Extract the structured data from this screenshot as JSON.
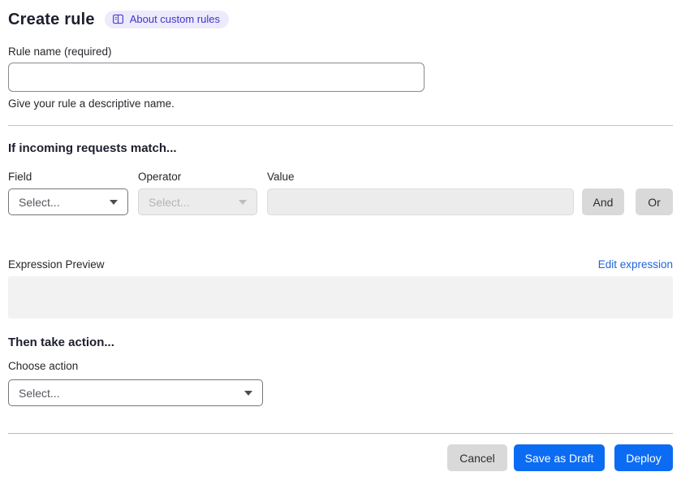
{
  "header": {
    "title": "Create rule",
    "about_badge": {
      "label": "About custom rules",
      "icon": "book-icon"
    }
  },
  "rule_name": {
    "label": "Rule name (required)",
    "value": "",
    "helper": "Give your rule a descriptive name."
  },
  "match_section": {
    "title": "If incoming requests match...",
    "columns": {
      "field": {
        "label": "Field",
        "selected": "Select...",
        "enabled": true
      },
      "operator": {
        "label": "Operator",
        "selected": "Select...",
        "enabled": false
      },
      "value": {
        "label": "Value",
        "value": "",
        "enabled": false
      }
    },
    "and_button": "And",
    "or_button": "Or"
  },
  "expression": {
    "label": "Expression Preview",
    "edit_link": "Edit expression",
    "preview_value": ""
  },
  "action_section": {
    "title": "Then take action...",
    "choose_label": "Choose action",
    "selected": "Select..."
  },
  "footer": {
    "cancel": "Cancel",
    "save_draft": "Save as Draft",
    "deploy": "Deploy"
  },
  "colors": {
    "primary_blue": "#0b6cf3",
    "link_blue": "#2065d6",
    "badge_bg": "#edeafc",
    "badge_text": "#3d35cb",
    "gray_button": "#d9d9d9",
    "disabled_bg": "#ececec",
    "preview_bg": "#f2f2f2",
    "divider": "#c3c3c3",
    "heading_text": "#1d1f2e"
  }
}
